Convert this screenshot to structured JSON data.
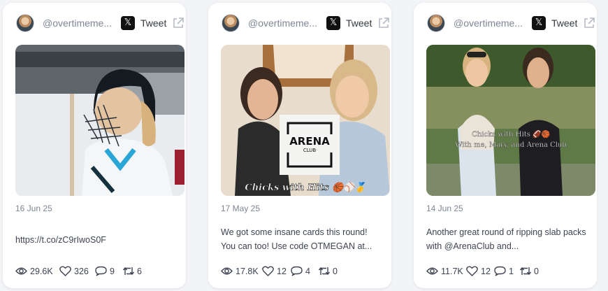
{
  "cards": [
    {
      "handle": "@overtimeme...",
      "tweet_label": "Tweet",
      "date": "16 Jun 25",
      "text": "https://t.co/zC9rIwoS0F",
      "stats": {
        "views": "29.6K",
        "likes": "326",
        "replies": "9",
        "retweets": "6"
      }
    },
    {
      "handle": "@overtimeme...",
      "tweet_label": "Tweet",
      "date": "17 May 25",
      "text": "We got some insane cards this round! You can too! Use code OTMEGAN at...",
      "media_overlay": {
        "logo_top": "ARENA",
        "logo_bottom": "CLUB",
        "caption": "Chicks with Hits 🏀⚾🥇"
      },
      "stats": {
        "views": "17.8K",
        "likes": "12",
        "replies": "4",
        "retweets": "0"
      }
    },
    {
      "handle": "@overtimeme...",
      "tweet_label": "Tweet",
      "date": "14 Jun 25",
      "text": "Another great round of ripping slab packs with @ArenaClub and...",
      "media_overlay": {
        "caption_line1": "Chicks with Hits 🏈🏀",
        "caption_line2": "With me, Mary, and Arena Club"
      },
      "stats": {
        "views": "11.7K",
        "likes": "12",
        "replies": "1",
        "retweets": "0"
      }
    }
  ],
  "icons": {
    "x_logo": "x-logo-icon",
    "external": "external-link-icon",
    "views": "eye-icon",
    "likes": "heart-icon",
    "replies": "comment-icon",
    "retweets": "retweet-icon"
  }
}
